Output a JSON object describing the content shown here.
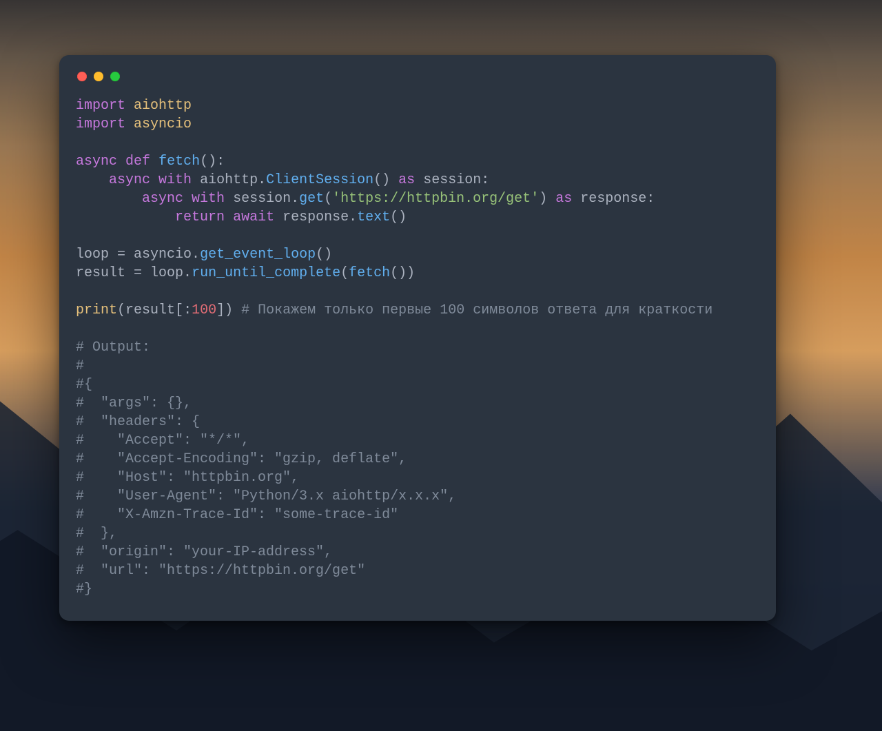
{
  "colors": {
    "windowBg": "#2b3440",
    "trafficRed": "#ff5f56",
    "trafficYellow": "#ffbd2e",
    "trafficGreen": "#27c93f",
    "keyword": "#c678dd",
    "module": "#e5c07b",
    "function": "#61afef",
    "string": "#98c379",
    "numberHighlight": "#e06c75",
    "comment": "#7f8a99",
    "default": "#abb2bf"
  },
  "code": {
    "line1": {
      "import": "import",
      "mod": "aiohttp"
    },
    "line2": {
      "import": "import",
      "mod": "asyncio"
    },
    "line4": {
      "async": "async",
      "def": "def",
      "name": "fetch",
      "parens": "():"
    },
    "line5": {
      "indent": "    ",
      "async": "async",
      "with": "with",
      "mod": "aiohttp",
      "dot": ".",
      "cls": "ClientSession",
      "call": "()",
      "as": "as",
      "var": "session",
      "colon": ":"
    },
    "line6": {
      "indent": "        ",
      "async": "async",
      "with": "with",
      "obj": "session",
      "dot": ".",
      "method": "get",
      "lpar": "(",
      "str": "'https://httpbin.org/get'",
      "rpar": ")",
      "as": "as",
      "var": "response",
      "colon": ":"
    },
    "line7": {
      "indent": "            ",
      "return": "return",
      "await": "await",
      "obj": "response",
      "dot": ".",
      "method": "text",
      "call": "()"
    },
    "line9": {
      "lhs": "loop",
      "eq": " = ",
      "mod": "asyncio",
      "dot": ".",
      "fn": "get_event_loop",
      "call": "()"
    },
    "line10": {
      "lhs": "result",
      "eq": " = ",
      "obj": "loop",
      "dot": ".",
      "fn": "run_until_complete",
      "lpar": "(",
      "arg": "fetch",
      "argcall": "()",
      "rpar": ")"
    },
    "line12": {
      "print": "print",
      "lpar": "(",
      "obj": "result",
      "lbrk": "[",
      "colon": ":",
      "num": "100",
      "rbrk": "]",
      "rpar": ")",
      "sp": " ",
      "comment": "# Покажем только первые 100 символов ответа для краткости"
    },
    "out1": "# Output:",
    "out2": "#",
    "out3": "#{",
    "out4": "#  \"args\": {},",
    "out5": "#  \"headers\": {",
    "out6": "#    \"Accept\": \"*/*\",",
    "out7": "#    \"Accept-Encoding\": \"gzip, deflate\",",
    "out8": "#    \"Host\": \"httpbin.org\",",
    "out9": "#    \"User-Agent\": \"Python/3.x aiohttp/x.x.x\",",
    "out10": "#    \"X-Amzn-Trace-Id\": \"some-trace-id\"",
    "out11": "#  },",
    "out12": "#  \"origin\": \"your-IP-address\",",
    "out13": "#  \"url\": \"https://httpbin.org/get\"",
    "out14": "#}"
  }
}
